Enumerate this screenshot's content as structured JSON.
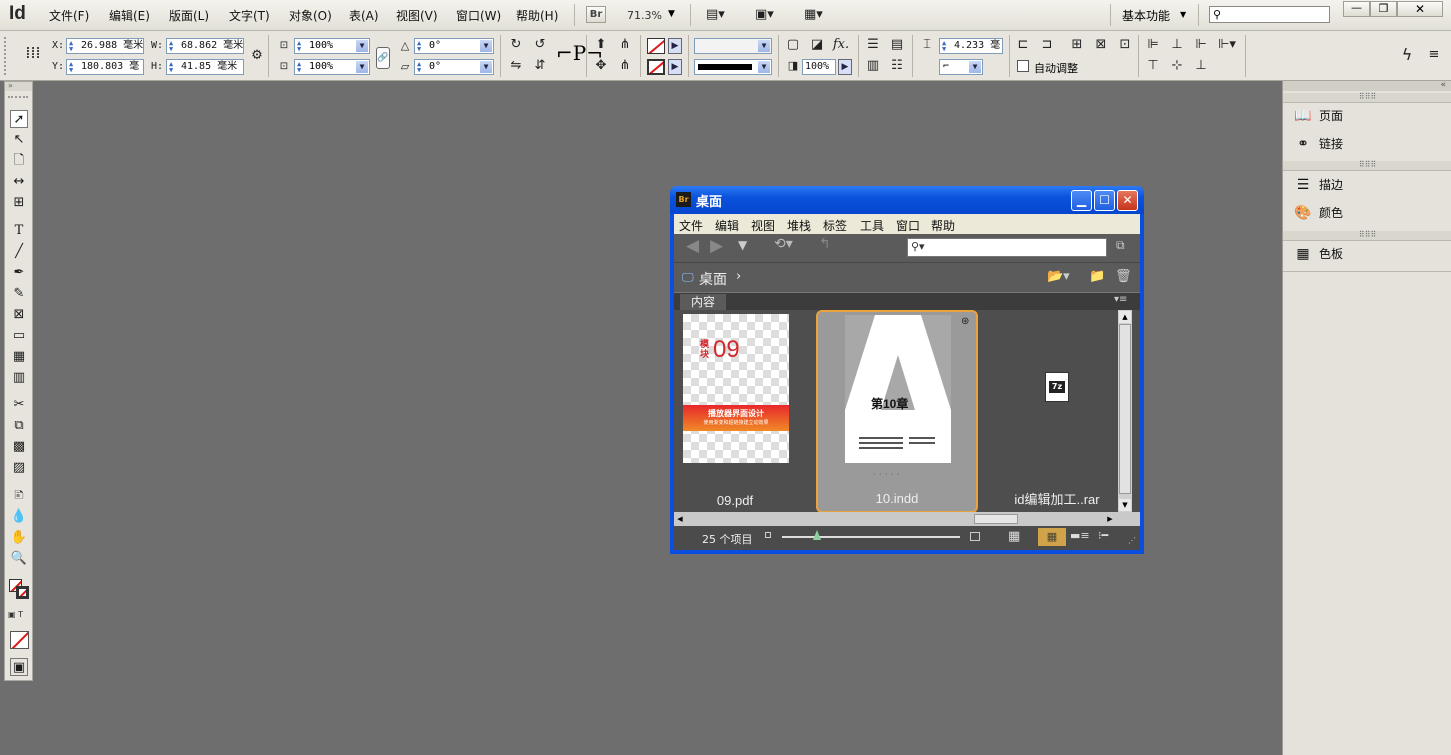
{
  "app": {
    "logo": "Id",
    "menu": [
      "文件(F)",
      "编辑(E)",
      "版面(L)",
      "文字(T)",
      "对象(O)",
      "表(A)",
      "视图(V)",
      "窗口(W)",
      "帮助(H)"
    ],
    "bridge_button": "Br",
    "zoom": "71.3%",
    "workspace": "基本功能"
  },
  "control": {
    "x_label": "X:",
    "x_value": "26.988 毫米",
    "y_label": "Y:",
    "y_value": "180.803 毫",
    "w_label": "W:",
    "w_value": "68.862 毫米",
    "h_label": "H:",
    "h_value": "41.85 毫米",
    "scale_x": "100%",
    "scale_y": "100%",
    "rotate": "0°",
    "shear": "0°",
    "stroke_weight": "4.233 毫",
    "opacity": "100%",
    "auto_fit": "自动调整"
  },
  "right_panels": {
    "group1": [
      {
        "icon": "pages-icon",
        "label": "页面"
      },
      {
        "icon": "links-icon",
        "label": "链接"
      }
    ],
    "group2": [
      {
        "icon": "stroke-icon",
        "label": "描边"
      },
      {
        "icon": "color-icon",
        "label": "颜色"
      }
    ],
    "group3": [
      {
        "icon": "swatches-icon",
        "label": "色板"
      }
    ]
  },
  "bridge": {
    "app_icon": "Br",
    "title": "桌面",
    "menu": [
      "文件",
      "编辑",
      "视图",
      "堆栈",
      "标签",
      "工具",
      "窗口",
      "帮助"
    ],
    "path": "桌面",
    "content_tab": "内容",
    "items": [
      {
        "name": "09.pdf",
        "badge": "模块",
        "number": "09",
        "banner": "播放器界面设计",
        "banner_sub": "使用渐变和超链接建立动效果"
      },
      {
        "name": "10.indd",
        "chapter": "第10章"
      },
      {
        "name": "id编辑加工..rar",
        "icon_text": "7z"
      }
    ],
    "item_count": "25 个项目",
    "colors": {
      "accent": "#e8a33c",
      "title_bar": "#0b52dc",
      "close": "#c3341a"
    }
  }
}
